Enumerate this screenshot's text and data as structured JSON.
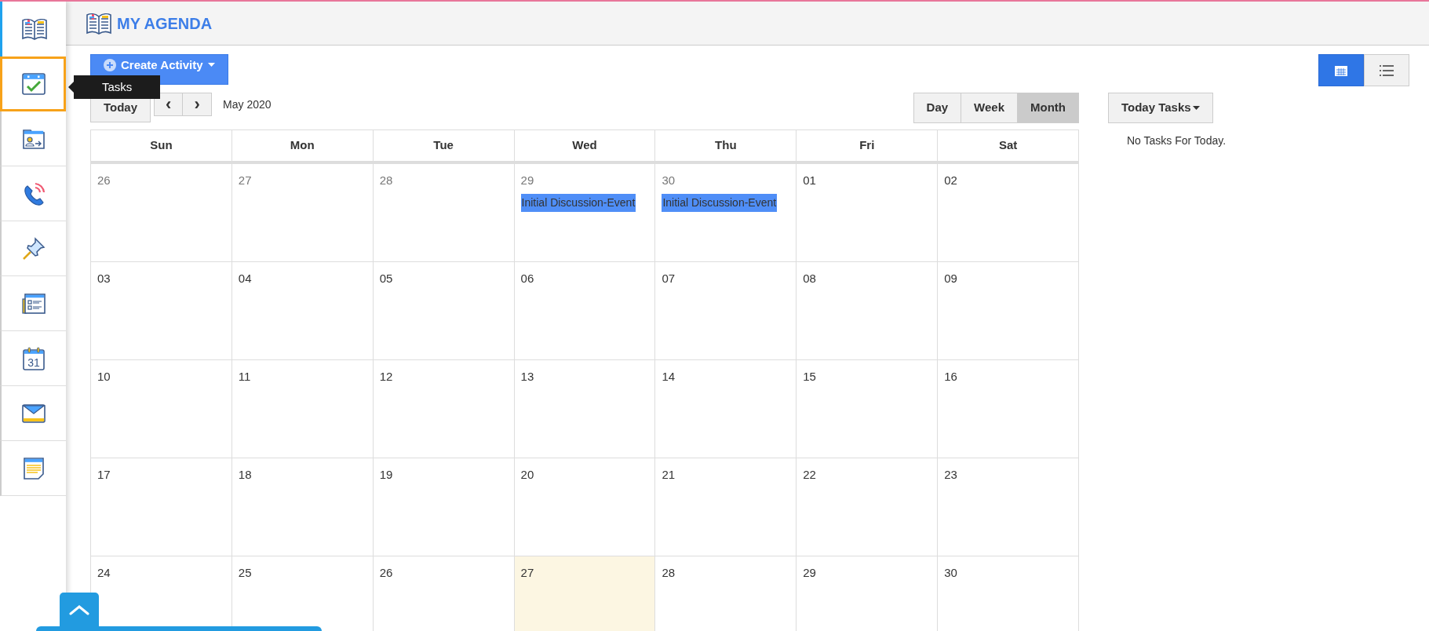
{
  "sidebar": {
    "items": [
      {
        "selected": true,
        "highlighted": false
      },
      {
        "selected": false,
        "highlighted": true
      },
      {
        "selected": false,
        "highlighted": false
      },
      {
        "selected": false,
        "highlighted": false
      },
      {
        "selected": false,
        "highlighted": false
      },
      {
        "selected": false,
        "highlighted": false
      },
      {
        "icon_text": "31",
        "selected": false,
        "highlighted": false
      },
      {
        "selected": false,
        "highlighted": false
      },
      {
        "selected": false,
        "highlighted": false
      }
    ]
  },
  "tooltip": {
    "text": "Tasks"
  },
  "header": {
    "title": "MY AGENDA"
  },
  "create_button": {
    "label": "Create Activity"
  },
  "view_toggle": [
    {
      "selected": true
    },
    {
      "selected": false
    }
  ],
  "calendar": {
    "today_button": "Today",
    "prev": "‹",
    "next": "›",
    "title": "May 2020",
    "views": [
      {
        "label": "Day",
        "selected": false
      },
      {
        "label": "Week",
        "selected": false
      },
      {
        "label": "Month",
        "selected": true
      }
    ],
    "weekdays": [
      "Sun",
      "Mon",
      "Tue",
      "Wed",
      "Thu",
      "Fri",
      "Sat"
    ],
    "weeks": [
      [
        {
          "label": "26",
          "muted": true,
          "today": false
        },
        {
          "label": "27",
          "muted": true,
          "today": false
        },
        {
          "label": "28",
          "muted": true,
          "today": false
        },
        {
          "label": "29",
          "muted": true,
          "today": false,
          "events": [
            {
              "title": "Initial Discussion-Event",
              "color": "#4f8ef7"
            }
          ]
        },
        {
          "label": "30",
          "muted": true,
          "today": false,
          "events": [
            {
              "title": "Initial Discussion-Event",
              "color": "#4f8ef7"
            }
          ]
        },
        {
          "label": "01",
          "muted": false,
          "today": false
        },
        {
          "label": "02",
          "muted": false,
          "today": false
        }
      ],
      [
        {
          "label": "03",
          "muted": false,
          "today": false
        },
        {
          "label": "04",
          "muted": false,
          "today": false
        },
        {
          "label": "05",
          "muted": false,
          "today": false
        },
        {
          "label": "06",
          "muted": false,
          "today": false
        },
        {
          "label": "07",
          "muted": false,
          "today": false
        },
        {
          "label": "08",
          "muted": false,
          "today": false
        },
        {
          "label": "09",
          "muted": false,
          "today": false
        }
      ],
      [
        {
          "label": "10",
          "muted": false,
          "today": false
        },
        {
          "label": "11",
          "muted": false,
          "today": false
        },
        {
          "label": "12",
          "muted": false,
          "today": false
        },
        {
          "label": "13",
          "muted": false,
          "today": false
        },
        {
          "label": "14",
          "muted": false,
          "today": false
        },
        {
          "label": "15",
          "muted": false,
          "today": false
        },
        {
          "label": "16",
          "muted": false,
          "today": false
        }
      ],
      [
        {
          "label": "17",
          "muted": false,
          "today": false
        },
        {
          "label": "18",
          "muted": false,
          "today": false
        },
        {
          "label": "19",
          "muted": false,
          "today": false
        },
        {
          "label": "20",
          "muted": false,
          "today": false
        },
        {
          "label": "21",
          "muted": false,
          "today": false
        },
        {
          "label": "22",
          "muted": false,
          "today": false
        },
        {
          "label": "23",
          "muted": false,
          "today": false
        }
      ],
      [
        {
          "label": "24",
          "muted": false,
          "today": false
        },
        {
          "label": "25",
          "muted": false,
          "today": false
        },
        {
          "label": "26",
          "muted": false,
          "today": false
        },
        {
          "label": "27",
          "muted": false,
          "today": true
        },
        {
          "label": "28",
          "muted": false,
          "today": false
        },
        {
          "label": "29",
          "muted": false,
          "today": false
        },
        {
          "label": "30",
          "muted": false,
          "today": false
        }
      ]
    ]
  },
  "tasks_panel": {
    "button": "Today Tasks",
    "message": "No Tasks For Today."
  }
}
